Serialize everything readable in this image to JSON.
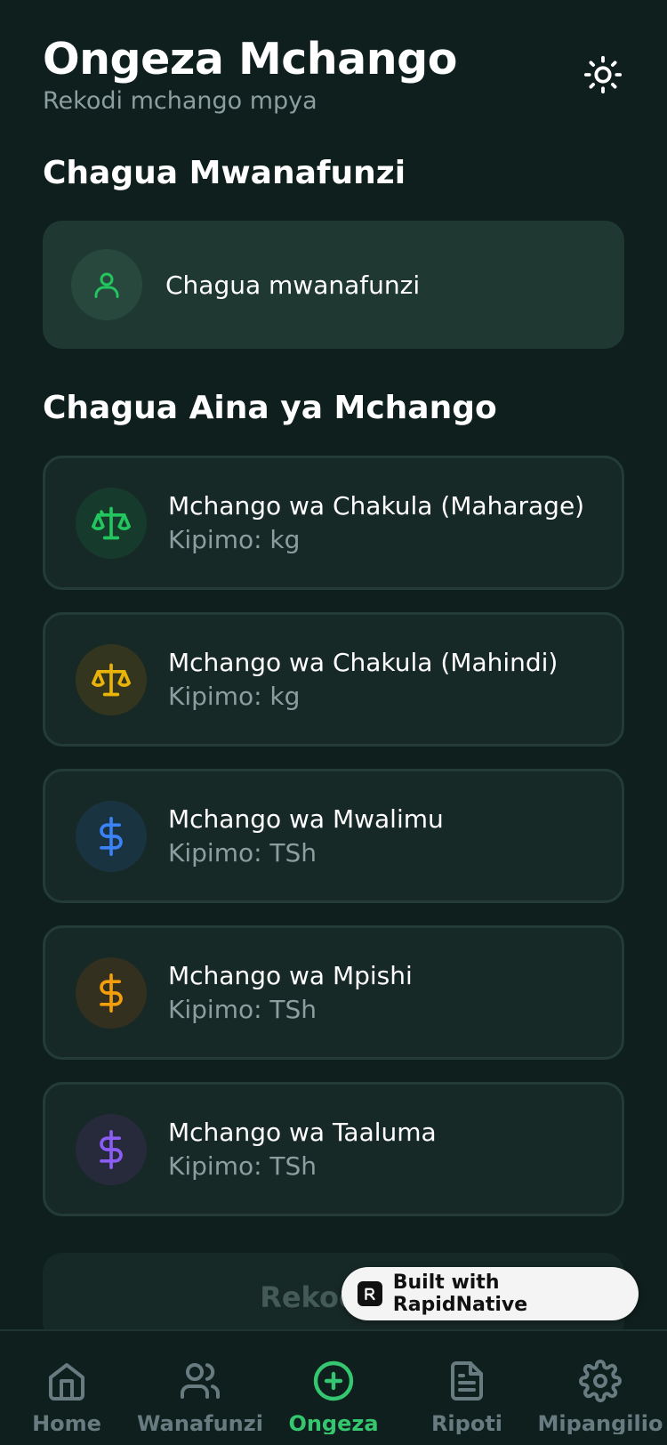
{
  "header": {
    "title": "Ongeza Mchango",
    "subtitle": "Rekodi mchango mpya"
  },
  "student_section": {
    "title": "Chagua Mwanafunzi",
    "select_label": "Chagua mwanafunzi"
  },
  "types_section": {
    "title": "Chagua Aina ya Mchango",
    "items": [
      {
        "name": "Mchango wa Chakula (Maharage)",
        "unit": "Kipimo: kg",
        "icon": "scale-icon",
        "color": "#22c55e",
        "bg": "#163a2b"
      },
      {
        "name": "Mchango wa Chakula (Mahindi)",
        "unit": "Kipimo: kg",
        "icon": "scale-icon",
        "color": "#eab308",
        "bg": "#33351f"
      },
      {
        "name": "Mchango wa Mwalimu",
        "unit": "Kipimo: TSh",
        "icon": "dollar-icon",
        "color": "#3b82f6",
        "bg": "#1a3340"
      },
      {
        "name": "Mchango wa Mpishi",
        "unit": "Kipimo: TSh",
        "icon": "dollar-icon",
        "color": "#f59e0b",
        "bg": "#33301f"
      },
      {
        "name": "Mchango wa Taaluma",
        "unit": "Kipimo: TSh",
        "icon": "dollar-icon",
        "color": "#8b5cf6",
        "bg": "#262a3b"
      }
    ]
  },
  "submit_button": {
    "label": "Rekodi M"
  },
  "badge": {
    "label": "Built with RapidNative"
  },
  "tabbar": {
    "tabs": [
      {
        "label": "Home",
        "icon": "home-icon"
      },
      {
        "label": "Wanafunzi",
        "icon": "users-icon"
      },
      {
        "label": "Ongeza",
        "icon": "plus-circle-icon"
      },
      {
        "label": "Ripoti",
        "icon": "document-icon"
      },
      {
        "label": "Mipangilio",
        "icon": "gear-icon"
      }
    ],
    "active_tab": "Ongeza",
    "active_color": "#34c76f",
    "inactive_color": "#687b80"
  }
}
